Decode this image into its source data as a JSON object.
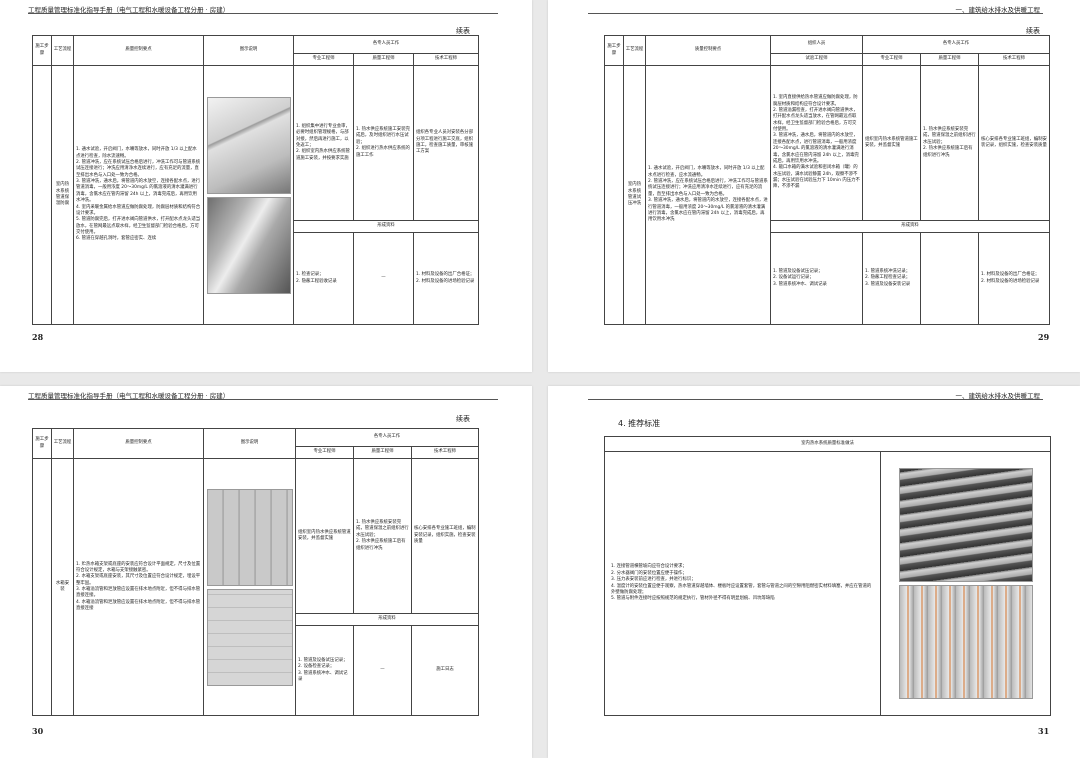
{
  "pages": {
    "p28": {
      "header": "工程质量管理标准化指导手册（电气工程和水暖设备工程分册 · 房建）",
      "continued": "续表",
      "number": "28",
      "cols": [
        "施工步骤",
        "工艺流程",
        "质量控制要点",
        "图示说明",
        "各专人员工作"
      ],
      "roles": [
        "专业工程师",
        "质量工程师",
        "技术工程师"
      ],
      "step": "室内热水系统管道保温防腐",
      "points": "1. 通水试验，开启阀门，水嘴等放水，同时开放 1/3 以上配水点进行检查，除水流速畅。\n2. 管道冲洗，应在系统试压合格后进行，冲洗工作可与管道系统试压连接进行；冲洗应用清净水连续进行，应有充足的流量，直至排出水色与入口处一致为合格。\n3. 管道冲洗，通水后，将管道内的水放空，连接各配水点，进行管道消毒，一般用浓度 20～30mg/L 的氯溶液的清水灌满进行消毒，含氯水应在管内滞留 24h 以上，消毒完成后，再用饮用水冲洗。\n4. 室内采暖金属给水管道应做防腐处理，防腐层材质和结构符合设计要求。\n5. 管道防腐完后，打开进水阀向管道供水，打开配水点龙头适当放水，在管网最远点取水样，经卫生监督部门检验合格后，方可交付使用。\n6. 管道在穿越孔洞时，套管应密实、连续",
      "pro": "1. 组织集中进行专业会审，必要时组织管理规格，与部对接，然后再进行施工，以免返工；\n2. 组织室内热水供应系统管道施工安装，并按要求实施",
      "qual": "1. 热水供应系统施工安装完成后，及时组织进行水压试验；\n2. 组织进行热水供应系统的施工工作",
      "tech": "组织各专业人员对安装各分部分项工程进行施工交底，组织施工，检查施工质量，审核施工方案",
      "formHead": "形成资料",
      "formPro": "1. 检查记录；\n2. 隐蔽工程验收记录",
      "formQual": "—",
      "formTech": "1. 材料及设备的出厂合格证；\n2. 材料及设备的进场检验记录"
    },
    "p29": {
      "header": "一、建筑给水排水及供暖工程",
      "continued": "续表",
      "number": "29",
      "cols": [
        "施工步骤",
        "工艺流程",
        "质量控制要点",
        "组织人员",
        "各专人员工作"
      ],
      "roles": [
        "试验工程师",
        "专业工程师",
        "质量工程师",
        "技术工程师"
      ],
      "step": "室内热水系统管道试压冲洗",
      "points": "1. 通水试验，开启阀门，水嘴等放水，同时开放 1/3 以上配水点进行检查，应水流通畅。\n2. 管道冲洗，应在系统试压合格后进行，冲洗工作可与管道系统试压连接进行；冲洗应用清净水连续进行，应有充足的流量，直至排出水色与入口处一致为合格。\n3. 管道冲洗，通水后，将管道内的水放空，连接各配水点，进行管道消毒，一般用浓度 20～30mg/L 的氯溶液的清水灌满进行消毒，含氯水应在管内滞留 24h 以上，消毒完成后，再用饮用水冲洗",
      "test": "1. 室内直接供给热水管道应做防腐处理，防腐层材质和结构应符合设计要求。\n2. 管道溢漏检查，打开进水阀向管道供水，打开配水点龙头适当放水，在管网最远点取水样，经卫生监督部门检验合格后，方可交付使用。\n3. 管道冲洗，通水后，将管道内的水放空，连接各配水点，进行管道消毒，一般用浓度 20～30mg/L 的氯溶液的清水灌满进行消毒，含氯水应在管内滞留 24h 以上，消毒完成后，再用饮用水冲洗。\n4. 敞口水箱的满水试验和密闭水箱（罐）的水压试验，满水试验静置 24h，观察不渗不漏；水压试验在试验压力下 10min 内压力不降，不渗不漏",
      "pro": "组织室内热水系统管道施工安装，并监督实施",
      "qual": "1. 热水供应系统安装完成，管道保温之前组织进行水压试验；\n2. 热水供应系统施工后有组织进行冲洗",
      "tech": "核心安排各专业施工班组，编制安装记录，组织实施，检查安装质量",
      "formHead": "形成资料",
      "formTest": "1. 管道及设备试压记录；\n2. 设备试运行记录；\n3. 管道系统冲水、调试记录",
      "formPro": "1. 管道系统冲洗记录；\n2. 隐蔽工程检查记录；\n3. 管道及设备安装记录",
      "formTech": "1. 材料及设备的出厂合格证；\n2. 材料及设备的进场检验记录"
    },
    "p30": {
      "header": "工程质量管理标准化指导手册（电气工程和水暖设备工程分册 · 房建）",
      "continued": "续表",
      "number": "30",
      "cols": [
        "施工步骤",
        "工艺流程",
        "质量控制要点",
        "图示说明",
        "各专人员工作"
      ],
      "roles": [
        "专业工程师",
        "质量工程师",
        "技术工程师"
      ],
      "step": "水箱安装",
      "points": "1. 贮热水箱支架或底座的安装应符合设计平面规定，尺寸及位置符合设计规定，水箱与支架接触紧密。\n2. 水箱支架或底座安装，其尺寸及位置应符合设计规定，埋设平整牢固。\n3. 水箱溢流管和泄放管应设置在排水地点附近，但不得与排水管直接连接。\n4. 水箱溢流管和泄放管应设置在排水地点附近，但不得与排水管直接连接",
      "pro": "组织室内热水供应系统管道安装，并监督实施",
      "qual": "1. 热水供应系统安装完成，管道保温之前组织进行水压试验；\n2. 热水供应系统施工后有组织进行冲洗",
      "tech": "核心安排各专业施工班组，编制安装记录，组织实施，检查安装质量",
      "formHead": "形成资料",
      "formPro": "1. 管道及设备试压记录；\n2. 设备检查记录；\n3. 管道系统冲水、调试记录",
      "formQual": "—",
      "formTech": "施工日志"
    },
    "p31": {
      "header": "一、建筑给水排水及供暖工程",
      "number": "31",
      "section": "4. 推荐标准",
      "tableTitle": "室内热水系统质量标准做法",
      "points": "1. 连接管道横管坡向应符合设计要求；\n2. 分水器阀门的安装位置应便于操作；\n3. 压力表安装前应进行检查，并进行标识；\n4. 温度计的安装位置应便于观察，热水管道穿越墙体、楼板时应设置套管，套管与管道之间的空隙用阻燃密实材料填塞，并应在管道的外壁做防腐处理；\n5. 管道与附件连接时应按照规范的规定执行，管材外径不得有明显划痕、凹坑等缺陷"
    }
  }
}
